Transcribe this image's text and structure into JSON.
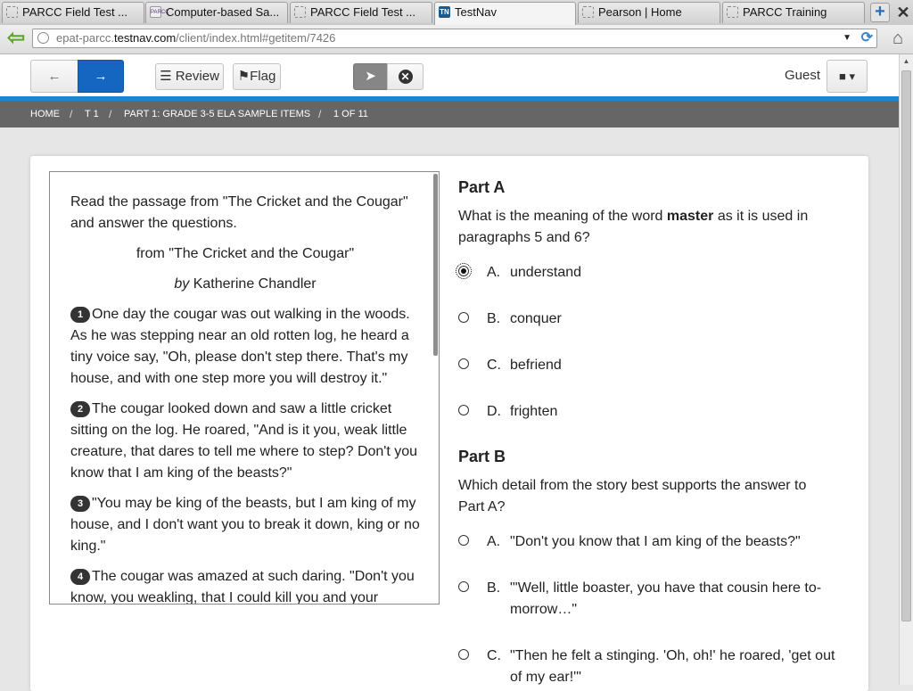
{
  "browser": {
    "tabs": [
      {
        "label": "PARCC Field Test ...",
        "icon": "blank-page-icon"
      },
      {
        "label": "Computer-based Sa...",
        "icon": "parcc-logo-icon"
      },
      {
        "label": "PARCC Field Test ...",
        "icon": "blank-page-icon"
      },
      {
        "label": "TestNav",
        "icon": "testnav-icon"
      },
      {
        "label": "Pearson | Home",
        "icon": "blank-page-icon"
      },
      {
        "label": "PARCC Training",
        "icon": "blank-page-icon"
      }
    ],
    "active_tab": 3,
    "url_prefix": "epat-parcc.",
    "url_domain": "testnav.com",
    "url_path": "/client/index.html#getitem/7426",
    "favicon_tn_text": "TN",
    "favicon_parcc_text": "PARCC"
  },
  "toolbar": {
    "review_label": "Review",
    "flag_label": "Flag",
    "user_label": "Guest"
  },
  "breadcrumb": [
    "HOME",
    "T 1",
    "PART 1: GRADE 3-5 ELA SAMPLE ITEMS",
    "1 OF 11"
  ],
  "passage": {
    "intro": "Read the passage from \"The Cricket and the Cougar\" and answer the questions.",
    "title": "from \"The Cricket and the Cougar\"",
    "by": "by",
    "author": "Katherine Chandler",
    "paragraphs": [
      {
        "num": "1",
        "text": "One day the cougar was out walking in the woods. As he was stepping near an old rotten log, he heard a tiny voice say, \"Oh, please don't step there. That's my house, and with one step more you will destroy it.\""
      },
      {
        "num": "2",
        "text": "The cougar looked down and saw a little cricket sitting on the log. He roared, \"And is it you, weak little creature, that dares to tell me where to step? Don't you know that I am king of the beasts?\""
      },
      {
        "num": "3",
        "text": "\"You may be king of the beasts, but I am king of my house, and I don't want you to break it down, king or no king.\""
      },
      {
        "num": "4",
        "text": "The cougar was amazed at such daring. \"Don't you know, you weakling, that I could kill you and your"
      }
    ]
  },
  "questions": {
    "part_a": {
      "heading": "Part A",
      "prompt_before": "What is the meaning of the word ",
      "prompt_bold": "master",
      "prompt_after": " as it is used in paragraphs 5 and 6?",
      "options": [
        {
          "letter": "A.",
          "text": "understand",
          "selected": true
        },
        {
          "letter": "B.",
          "text": "conquer",
          "selected": false
        },
        {
          "letter": "C.",
          "text": "befriend",
          "selected": false
        },
        {
          "letter": "D.",
          "text": "frighten",
          "selected": false
        }
      ]
    },
    "part_b": {
      "heading": "Part B",
      "prompt": "Which detail from the story best supports the answer to Part A?",
      "options": [
        {
          "letter": "A.",
          "text": "\"Don't you know that I am king of the beasts?\"",
          "selected": false
        },
        {
          "letter": "B.",
          "text": "\"'Well, little boaster, you have that cousin here to-morrow…\"",
          "selected": false
        },
        {
          "letter": "C.",
          "text": "\"Then he felt a stinging. 'Oh, oh!' he roared, 'get out of my ear!'\"",
          "selected": false
        }
      ]
    }
  },
  "colors": {
    "accent_blue": "#1466c1",
    "breadcrumb_bg": "#666666",
    "divider_blue": "#1a86d0"
  }
}
